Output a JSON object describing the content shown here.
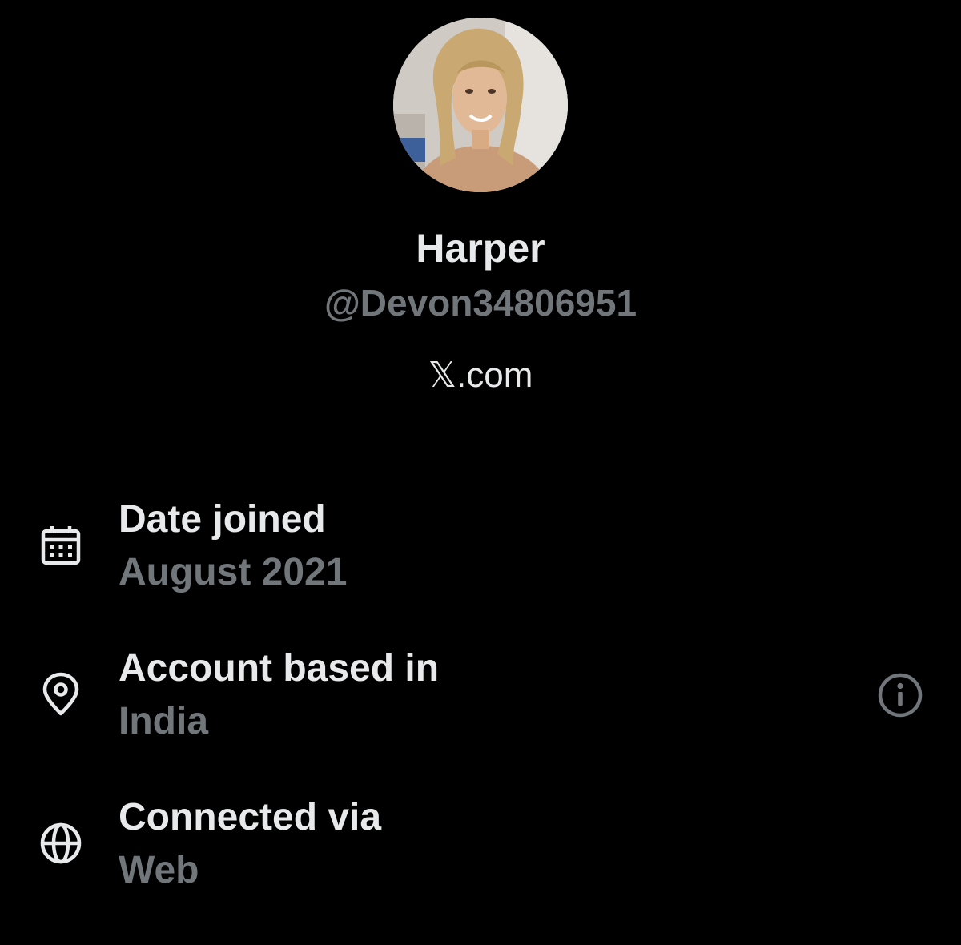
{
  "profile": {
    "display_name": "Harper",
    "handle": "@Devon34806951",
    "site_glyph": "𝕏",
    "site_suffix": ".com",
    "avatar_icon": "profile-photo"
  },
  "about": {
    "items": [
      {
        "icon": "calendar-icon",
        "label": "Date joined",
        "value": "August 2021"
      },
      {
        "icon": "location-pin-icon",
        "label": "Account based in",
        "value": "India",
        "extra_icon": "info-icon"
      },
      {
        "icon": "globe-icon",
        "label": "Connected via",
        "value": "Web"
      }
    ]
  },
  "colors": {
    "background": "#000000",
    "primary_text": "#e7e9ea",
    "secondary_text": "#71767b"
  }
}
